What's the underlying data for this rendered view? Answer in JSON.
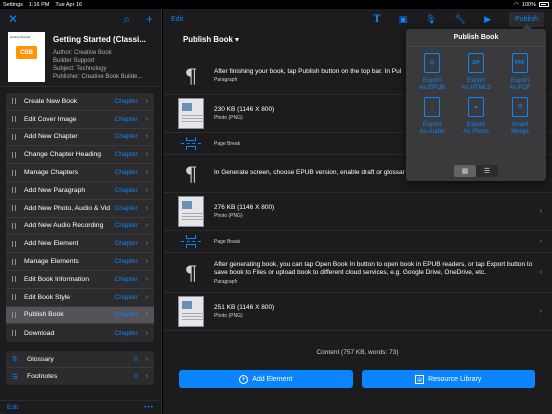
{
  "status": {
    "left": "Settings",
    "time": "1:16 PM",
    "date": "Tue Apr 16",
    "battery": "100%"
  },
  "sidebar": {
    "book": {
      "title": "Getting Started (Classi...",
      "author": "Author: Creative Book",
      "author2": "Builder Support",
      "subject": "Subject: Technology",
      "publisher": "Publisher: Creative Book Builde...",
      "cover_text": "Getting Started",
      "cover_logo": "CBB"
    },
    "items": [
      {
        "label": "Create New Book",
        "kind": "Chapter"
      },
      {
        "label": "Edit Cover Image",
        "kind": "Chapter"
      },
      {
        "label": "Add New Chapter",
        "kind": "Chapter"
      },
      {
        "label": "Change Chapter Heading",
        "kind": "Chapter"
      },
      {
        "label": "Manage Chapters",
        "kind": "Chapter"
      },
      {
        "label": "Add New Paragraph",
        "kind": "Chapter"
      },
      {
        "label": "Add New Photo, Audio & Video",
        "kind": "Chapter"
      },
      {
        "label": "Add New Audio Recording",
        "kind": "Chapter"
      },
      {
        "label": "Add New Element",
        "kind": "Chapter"
      },
      {
        "label": "Manage Elements",
        "kind": "Chapter"
      },
      {
        "label": "Edit Book Information",
        "kind": "Chapter"
      },
      {
        "label": "Edit Book Style",
        "kind": "Chapter"
      },
      {
        "label": "Publish Book",
        "kind": "Chapter",
        "selected": true
      },
      {
        "label": "Download",
        "kind": "Chapter"
      }
    ],
    "extras": [
      {
        "label": "Glossary",
        "count": "0"
      },
      {
        "label": "Footnotes",
        "count": "0"
      }
    ],
    "bottom_edit": "Edit",
    "bottom_more": "•••"
  },
  "main": {
    "edit": "Edit",
    "publish": "Publish",
    "chapter_title": "Publish Book ▾",
    "rows": [
      {
        "type": "paragraph",
        "text": "After finishing your book, tap Publish button on the top bar. In Pul",
        "sub": "Paragraph"
      },
      {
        "type": "photo",
        "text": "230 KB (1146 X 800)",
        "sub": "Photo (PNG)"
      },
      {
        "type": "break",
        "text": "Page Break"
      },
      {
        "type": "paragraph",
        "text": "In Generate screen, choose EPUB version, enable draft or glossar book generation.",
        "sub": ""
      },
      {
        "type": "photo",
        "text": "276 KB (1146 X 800)",
        "sub": "Photo (PNG)"
      },
      {
        "type": "break",
        "text": "Page Break"
      },
      {
        "type": "paragraph",
        "text": "After generating book, you can tap Open Book In button to open book in EPUB readers, or tap Export button to save book to Files or upload book to different cloud services, e.g. Google Drive, OneDrive, etc.",
        "sub": "Paragraph"
      },
      {
        "type": "photo",
        "text": "251 KB (1146 X 800)",
        "sub": "Photo (PNG)"
      }
    ],
    "summary": "Content (757 KB, words: 73)",
    "add_element": "Add Element",
    "resource_library": "Resource Library"
  },
  "popover": {
    "title": "Publish Book",
    "items": [
      {
        "label1": "Export",
        "label2": "As EPUB",
        "glyph": "▤"
      },
      {
        "label1": "Export",
        "label2": "As HTML5",
        "glyph": "ZIP"
      },
      {
        "label1": "Export",
        "label2": "As PDF",
        "glyph": "PDF"
      },
      {
        "label1": "Export",
        "label2": "As Audio",
        "glyph": "♪"
      },
      {
        "label1": "Export",
        "label2": "As Photo",
        "glyph": "▲"
      },
      {
        "label1": "Smart",
        "label2": "Merge",
        "glyph": "⤭"
      }
    ]
  }
}
